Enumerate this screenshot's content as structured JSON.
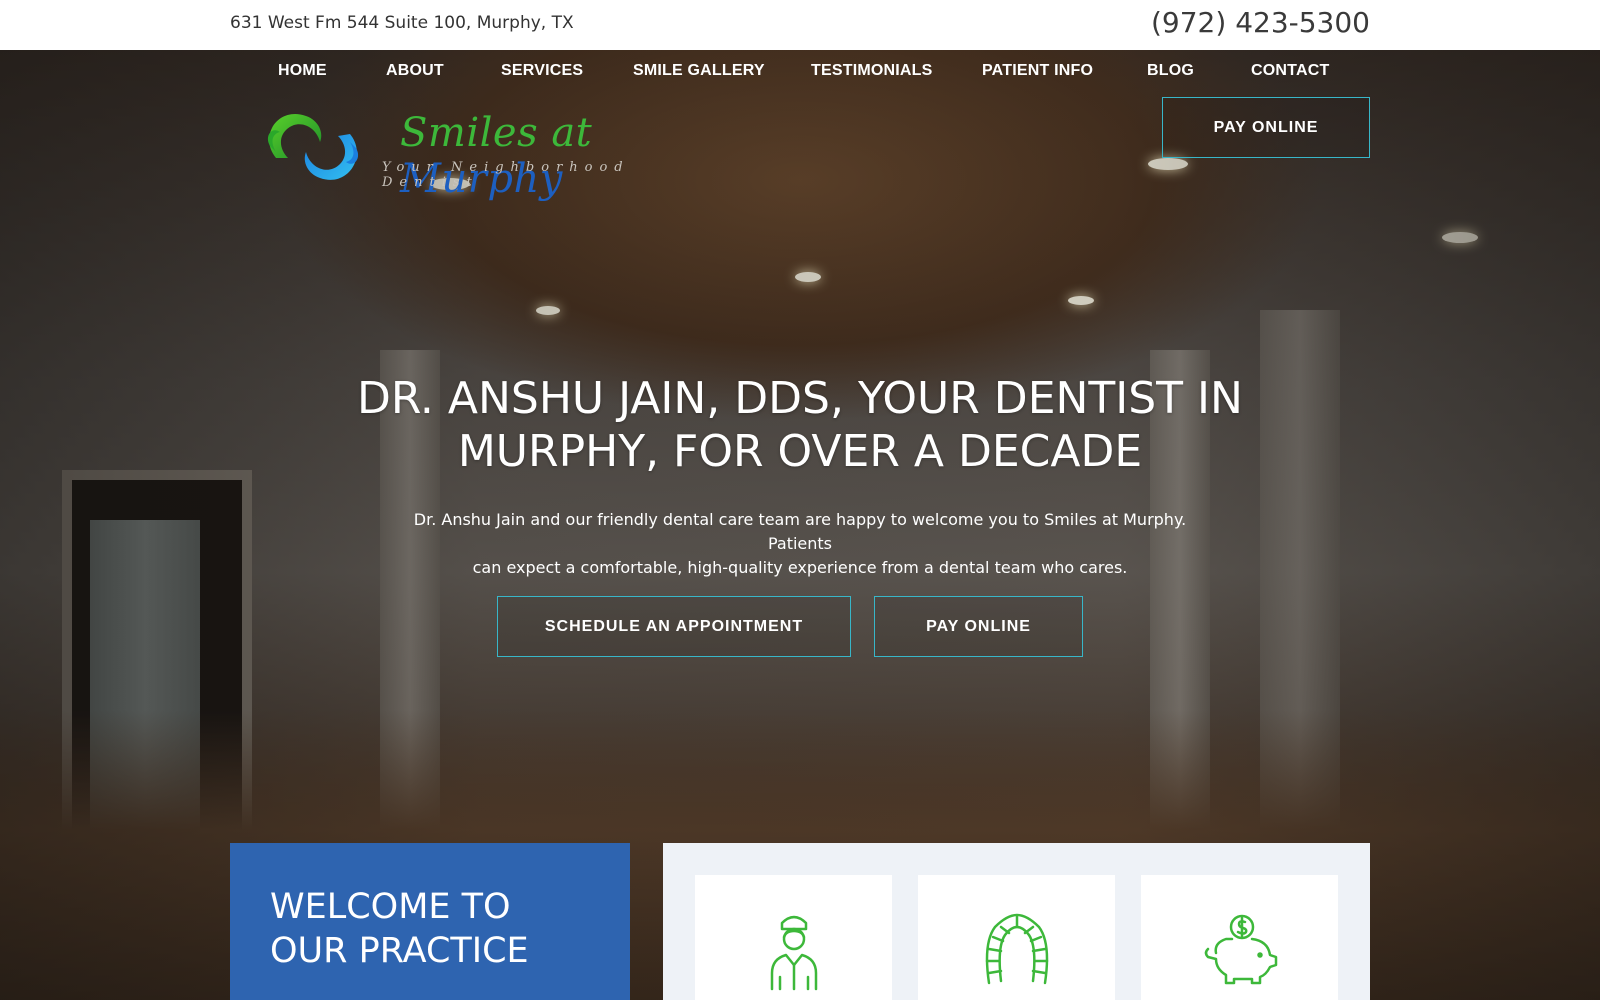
{
  "topbar": {
    "address": "631 West Fm 544 Suite 100, Murphy, TX",
    "phone": "(972) 423-5300"
  },
  "nav": {
    "items": [
      {
        "label": "HOME"
      },
      {
        "label": "ABOUT"
      },
      {
        "label": "SERVICES"
      },
      {
        "label": "SMILE GALLERY"
      },
      {
        "label": "TESTIMONIALS"
      },
      {
        "label": "PATIENT INFO"
      },
      {
        "label": "BLOG"
      },
      {
        "label": "CONTACT"
      }
    ]
  },
  "logo": {
    "brand_part1": "Smiles at ",
    "brand_part2": "Murphy",
    "tagline": "Your Neighborhood Dentist"
  },
  "header": {
    "pay_online_label": "PAY ONLINE"
  },
  "hero": {
    "headline_line1": "DR. ANSHU JAIN, DDS, YOUR DENTIST IN",
    "headline_line2": "MURPHY, FOR OVER A DECADE",
    "subtext_line1": "Dr. Anshu Jain and our friendly dental care team are happy to welcome you to Smiles at Murphy. Patients",
    "subtext_line2": "can expect a comfortable, high-quality experience from a dental team who cares.",
    "schedule_label": "SCHEDULE AN APPOINTMENT",
    "pay_label": "PAY ONLINE"
  },
  "welcome": {
    "line1": "WELCOME TO",
    "line2": "OUR PRACTICE"
  },
  "features": {
    "icons": [
      "dentist-person-icon",
      "dental-aligner-icon",
      "piggy-bank-icon"
    ]
  },
  "colors": {
    "accent_blue": "#2e64b0",
    "outline_teal": "#38b6c8",
    "icon_green": "#3db83a"
  }
}
